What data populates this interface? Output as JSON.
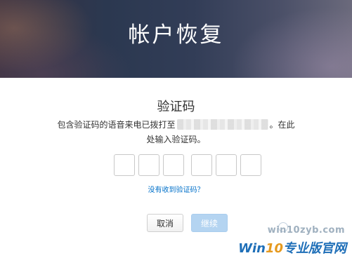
{
  "header": {
    "title": "帐户恢复"
  },
  "content": {
    "title": "验证码",
    "desc_prefix": "包含验证码的语音来电已拨打至",
    "desc_suffix": "。在此",
    "desc_line2": "处输入验证码。",
    "code_length": 6,
    "resend_link": "没有收到验证码？"
  },
  "buttons": {
    "cancel_label": "取消",
    "continue_label": "继续"
  },
  "watermark": {
    "site": "win10zyb.com",
    "brand_prefix": "Win",
    "brand_number": "10",
    "brand_suffix": "专业版官网"
  },
  "colors": {
    "link": "#0070c9",
    "continue_disabled_bg": "#b4d4f1",
    "brand_blue": "#1f6fb8",
    "brand_orange": "#e69a1f"
  }
}
